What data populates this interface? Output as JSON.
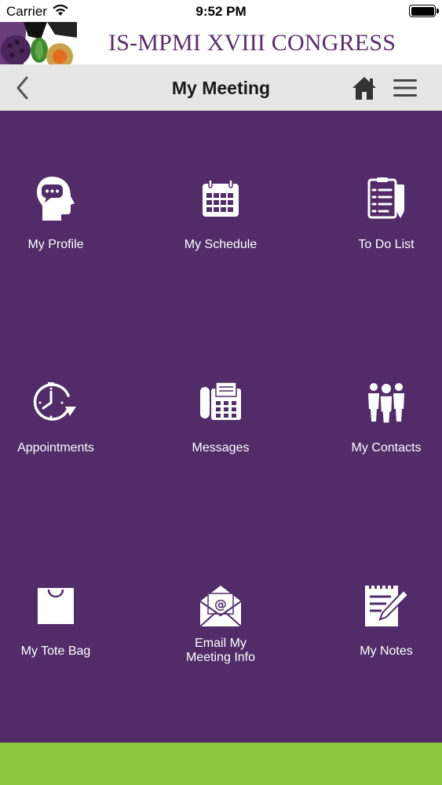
{
  "status_bar": {
    "carrier": "Carrier",
    "time": "9:52 PM"
  },
  "banner": {
    "title": "IS-MPMI XVIII CONGRESS"
  },
  "navbar": {
    "title": "My Meeting"
  },
  "tiles": [
    {
      "label": "My Profile",
      "icon": "profile-head-icon"
    },
    {
      "label": "My Schedule",
      "icon": "calendar-icon"
    },
    {
      "label": "To Do List",
      "icon": "checklist-icon"
    },
    {
      "label": "Appointments",
      "icon": "clock-icon"
    },
    {
      "label": "Messages",
      "icon": "phone-fax-icon"
    },
    {
      "label": "My Contacts",
      "icon": "contacts-group-icon"
    },
    {
      "label": "My Tote Bag",
      "icon": "bag-icon"
    },
    {
      "label": "Email My\nMeeting Info",
      "icon": "email-icon"
    },
    {
      "label": "My Notes",
      "icon": "notes-icon"
    }
  ],
  "colors": {
    "grid_bg": "#522c68",
    "footer": "#8dc63f",
    "navbar": "#e6e6e6",
    "brand": "#5a2d6b"
  }
}
